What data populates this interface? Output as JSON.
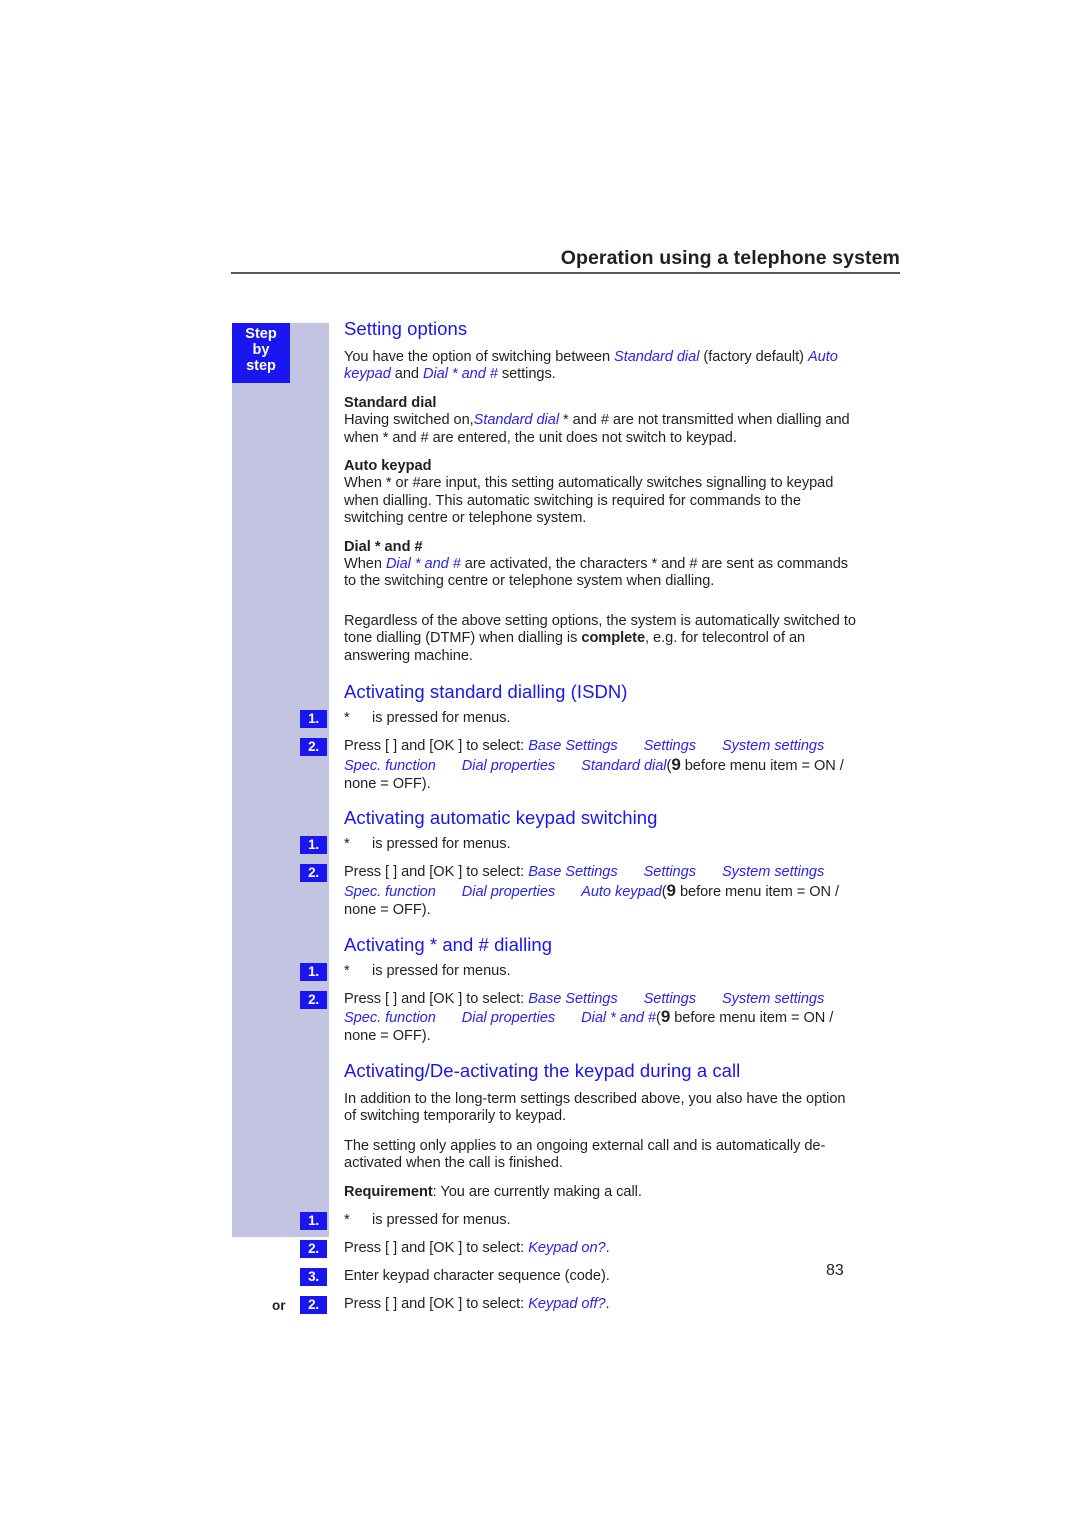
{
  "header": {
    "title": "Operation using a telephone system"
  },
  "sidebar": {
    "badge": [
      "Step",
      "by",
      "step"
    ]
  },
  "folio": "83",
  "sections": [
    {
      "id": "setting-options",
      "title": "Setting options",
      "intro_line1_a": "You have the option of switching between ",
      "intro_line1_i1": "Standard dial",
      "intro_line1_b": " (factory default) ",
      "intro_line1_i2": "Auto keypad",
      "intro_line1_c": " and ",
      "intro_line1_i3": "Dial * and #",
      "intro_line1_d": " settings.",
      "sub1_title": "Standard dial",
      "sub1_a": "Having switched on,",
      "sub1_i": "Standard dial",
      "sub1_b": " * and # are not transmitted when dialling and when * and # are entered, the unit does not switch to keypad.",
      "sub2_title": "Auto keypad",
      "sub2_text": "When * or #are input, this setting automatically switches signalling to keypad when dialling. This automatic switching is required for commands to the switching centre or telephone system.",
      "sub3_title": "Dial * and #",
      "sub3_a": "When ",
      "sub3_i": "Dial * and #",
      "sub3_b": " are activated, the characters  * and # are sent as commands to the switching centre or telephone system when dialling.",
      "outro_a": "Regardless of the above setting options, the system is automatically switched to tone dialling (DTMF) when dialling is ",
      "outro_bold": "complete",
      "outro_b": ", e.g. for telecontrol of an answering machine."
    },
    {
      "id": "activating-standard-dialling",
      "title": "Activating standard dialling (ISDN)",
      "steps": [
        {
          "num": "1.",
          "or": "",
          "star": "*",
          "text": "is pressed for menus."
        },
        {
          "num": "2.",
          "or": "",
          "press_a": "Press [   ] and [OK ] to select: ",
          "menu": [
            "Base Settings",
            "Settings",
            "System settings",
            "Spec. function",
            "Dial properties",
            "Standard dial"
          ],
          "tail_open": "(",
          "tail_check": "9",
          "tail_text": " before menu item = ON / none = OFF)."
        }
      ]
    },
    {
      "id": "activating-automatic-keypad-switching",
      "title": "Activating automatic keypad switching",
      "steps": [
        {
          "num": "1.",
          "or": "",
          "star": "*",
          "text": "is pressed for menus."
        },
        {
          "num": "2.",
          "or": "",
          "press_a": "Press [   ] and [OK ] to select: ",
          "menu": [
            "Base Settings",
            "Settings",
            "System settings",
            "Spec. function",
            "Dial properties",
            "Auto keypad"
          ],
          "tail_open": "(",
          "tail_check": "9",
          "tail_text": " before menu item = ON / none = OFF)."
        }
      ]
    },
    {
      "id": "activating-star-hash-dialling",
      "title": "Activating * and # dialling",
      "steps": [
        {
          "num": "1.",
          "or": "",
          "star": "*",
          "text": "is pressed for menus."
        },
        {
          "num": "2.",
          "or": "",
          "press_a": "Press [   ] and [OK ] to select: ",
          "menu": [
            "Base Settings",
            "Settings",
            "System settings",
            "Spec. function",
            "Dial properties",
            "Dial * and #"
          ],
          "tail_open": "(",
          "tail_check": "9",
          "tail_text": " before menu item = ON / none = OFF)."
        }
      ]
    },
    {
      "id": "activating-deactivating-keypad-during-call",
      "title": "Activating/De-activating the keypad during a call",
      "para1": "In addition to the long-term settings described above, you also have the option of switching temporarily to keypad.",
      "para2": "The setting only applies to an ongoing external call and is automatically de-activated when the call is finished.",
      "req_label": "Requirement",
      "req_text": ": You are currently making a call.",
      "steps": [
        {
          "num": "1.",
          "or": "",
          "star": "*",
          "text": "is pressed for menus."
        },
        {
          "num": "2.",
          "or": "",
          "press_a": "Press [   ] and [OK ] to select: ",
          "italic": "Keypad on?",
          "tail": "."
        },
        {
          "num": "3.",
          "or": "",
          "text": "Enter keypad character sequence (code)."
        },
        {
          "num": "2.",
          "or": "or",
          "press_a": "Press [   ] and [OK ] to select: ",
          "italic": "Keypad off?",
          "tail": "."
        }
      ]
    }
  ]
}
